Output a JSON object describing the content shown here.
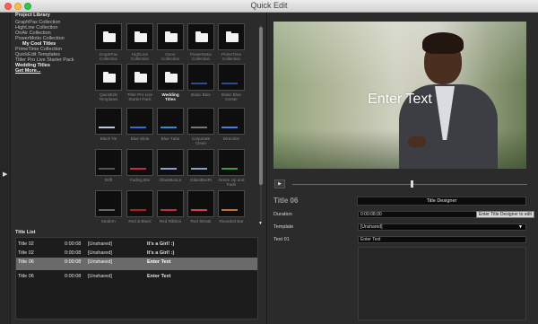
{
  "window": {
    "title": "Quick Edit"
  },
  "library": {
    "heading": "Project Library",
    "items": [
      {
        "label": "GraphPax Collection",
        "style": "normal"
      },
      {
        "label": "HighLine Collection",
        "style": "normal"
      },
      {
        "label": "OnAir Collection",
        "style": "normal"
      },
      {
        "label": "PowerMotio Collection",
        "style": "normal"
      },
      {
        "label": "My Cool Titles",
        "style": "indent"
      },
      {
        "label": "PrimeTime Collection",
        "style": "normal"
      },
      {
        "label": "QuickEdit Templates",
        "style": "normal"
      },
      {
        "label": "Titler Pro Live Starter Pack",
        "style": "normal"
      },
      {
        "label": "Wedding Titles",
        "style": "bold"
      },
      {
        "label": "Get More...",
        "style": "link"
      }
    ]
  },
  "grid": {
    "items": [
      {
        "label": "GraphPax Collection",
        "kind": "folder",
        "bar": ""
      },
      {
        "label": "HighLine Collection",
        "kind": "folder",
        "bar": ""
      },
      {
        "label": "OnAir Collection",
        "kind": "folder",
        "bar": ""
      },
      {
        "label": "PowerMotio Collection",
        "kind": "folder",
        "bar": ""
      },
      {
        "label": "PrimeTime Collection",
        "kind": "folder",
        "bar": ""
      },
      {
        "label": "QuickEdit Templates",
        "kind": "folder",
        "bar": ""
      },
      {
        "label": "Titler Pro Live Starter Pack",
        "kind": "folder",
        "bar": ""
      },
      {
        "label": "Wedding Titles",
        "kind": "folder",
        "bar": "",
        "selected": true
      },
      {
        "label": "Basic Blue",
        "kind": "dark",
        "bar": "#2a4f9a"
      },
      {
        "label": "Basic Blue Center",
        "kind": "dark",
        "bar": "#2a4f9a"
      },
      {
        "label": "Black Tie",
        "kind": "dark",
        "bar": "#bfc7d6"
      },
      {
        "label": "Blue Slide",
        "kind": "dark",
        "bar": "#3a6bd0"
      },
      {
        "label": "Blue Tube",
        "kind": "dark",
        "bar": "#3a8ad0"
      },
      {
        "label": "Corporate Clean",
        "kind": "dark",
        "bar": "#777777"
      },
      {
        "label": "Direction",
        "kind": "dark",
        "bar": "#4a7fd8"
      },
      {
        "label": "Drift",
        "kind": "dark",
        "bar": "#555555"
      },
      {
        "label": "Fading Bar",
        "kind": "dark",
        "bar": "#c0303a"
      },
      {
        "label": "GlassBoxLe",
        "kind": "dark",
        "bar": "#8aa0c8"
      },
      {
        "label": "GlassBoxRi",
        "kind": "dark",
        "bar": "#8aa0c8"
      },
      {
        "label": "Green Up and Fade",
        "kind": "dark",
        "bar": "#3aa040"
      },
      {
        "label": "Modern",
        "kind": "dark",
        "bar": "#666666"
      },
      {
        "label": "Red & Black",
        "kind": "dark",
        "bar": "#b02020"
      },
      {
        "label": "Red Ribbon",
        "kind": "dark",
        "bar": "#c03040"
      },
      {
        "label": "Red Streak",
        "kind": "dark",
        "bar": "#d04050"
      },
      {
        "label": "Rounded Bar",
        "kind": "dark",
        "bar": "#c07030"
      }
    ]
  },
  "titlelist": {
    "heading": "Title List",
    "rows": [
      {
        "name": "Title 02",
        "duration": "0:00:08",
        "template": "[Unshared]",
        "text": "It's a Girl! :)"
      },
      {
        "name": "Title 02",
        "duration": "0:00:08",
        "template": "[Unshared]",
        "text": "It's a Girl! :)"
      },
      {
        "name": "Title 06",
        "duration": "0:00:08",
        "template": "[Unshared]",
        "text": "Enter Text",
        "selected": true
      },
      {
        "name": "Title 06",
        "duration": "0:00:08",
        "template": "[Unshared]",
        "text": "Enter Text"
      }
    ]
  },
  "preview": {
    "overlay_text": "Enter Text",
    "play_icon": "play-icon"
  },
  "properties": {
    "title": "Title 06",
    "designer_button": "Title Designer",
    "tooltip": "Enter Title Designer to edit",
    "duration_label": "Duration",
    "duration_value": "0:00:08;00",
    "template_label": "Template",
    "template_value": "[Unshared]",
    "text_label": "Text 01",
    "text_value": "Enter Text"
  }
}
